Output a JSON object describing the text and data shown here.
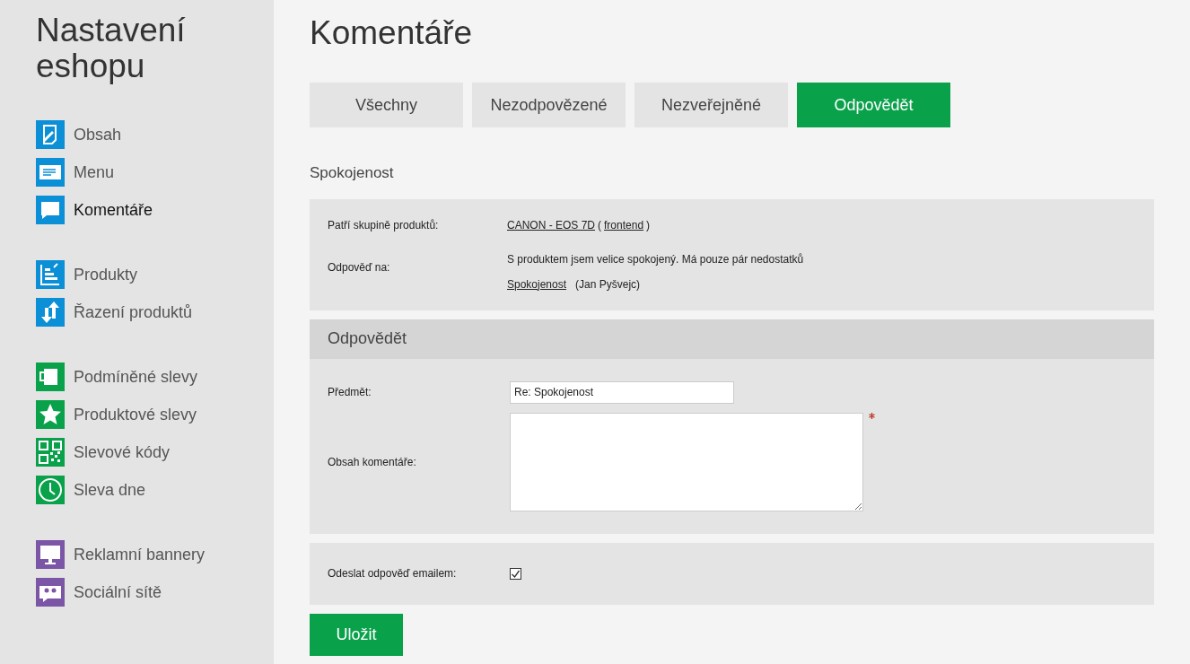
{
  "sidebar": {
    "title": "Nastavení eshopu",
    "groups": [
      {
        "items": [
          {
            "label": "Obsah",
            "kind": "page",
            "color": "#0b8fd6",
            "selected": false
          },
          {
            "label": "Menu",
            "kind": "menu",
            "color": "#0b8fd6",
            "selected": false
          },
          {
            "label": "Komentáře",
            "kind": "comment",
            "color": "#0b8fd6",
            "selected": true
          }
        ]
      },
      {
        "items": [
          {
            "label": "Produkty",
            "kind": "products",
            "color": "#0b8fd6",
            "selected": false
          },
          {
            "label": "Řazení produktů",
            "kind": "sort",
            "color": "#0b8fd6",
            "selected": false
          }
        ]
      },
      {
        "items": [
          {
            "label": "Podmíněné slevy",
            "kind": "mug",
            "color": "#0aa14b",
            "selected": false
          },
          {
            "label": "Produktové slevy",
            "kind": "star",
            "color": "#0aa14b",
            "selected": false
          },
          {
            "label": "Slevové kódy",
            "kind": "qr",
            "color": "#0aa14b",
            "selected": false
          },
          {
            "label": "Sleva dne",
            "kind": "clock",
            "color": "#0aa14b",
            "selected": false
          }
        ]
      },
      {
        "items": [
          {
            "label": "Reklamní bannery",
            "kind": "monitor",
            "color": "#7b55a6",
            "selected": false
          },
          {
            "label": "Sociální sítě",
            "kind": "people",
            "color": "#7b55a6",
            "selected": false
          }
        ]
      }
    ]
  },
  "main": {
    "title": "Komentáře",
    "tabs": [
      {
        "label": "Všechny",
        "selected": false
      },
      {
        "label": "Nezodpovězené",
        "selected": false
      },
      {
        "label": "Nezveřejněné",
        "selected": false
      },
      {
        "label": "Odpovědět",
        "selected": true
      }
    ],
    "section_title": "Spokojenost",
    "info": {
      "group_label": "Patří skupině produktů:",
      "group_link": "CANON - EOS 7D",
      "group_open": "(",
      "group_frontend": "frontend",
      "group_close": ")",
      "reply_label": "Odpověď na:",
      "reply_text": "S produktem jsem velice spokojený. Má pouze pár nedostatků",
      "reply_link": "Spokojenost",
      "reply_author": "(Jan Pyšvejc)"
    },
    "form": {
      "header": "Odpovědět",
      "subject_label": "Předmět:",
      "subject_value": "Re: Spokojenost",
      "content_label": "Obsah komentáře:",
      "content_required": true
    },
    "email": {
      "label": "Odeslat odpověď emailem:",
      "checked": true
    },
    "save_button": "Uložit"
  }
}
